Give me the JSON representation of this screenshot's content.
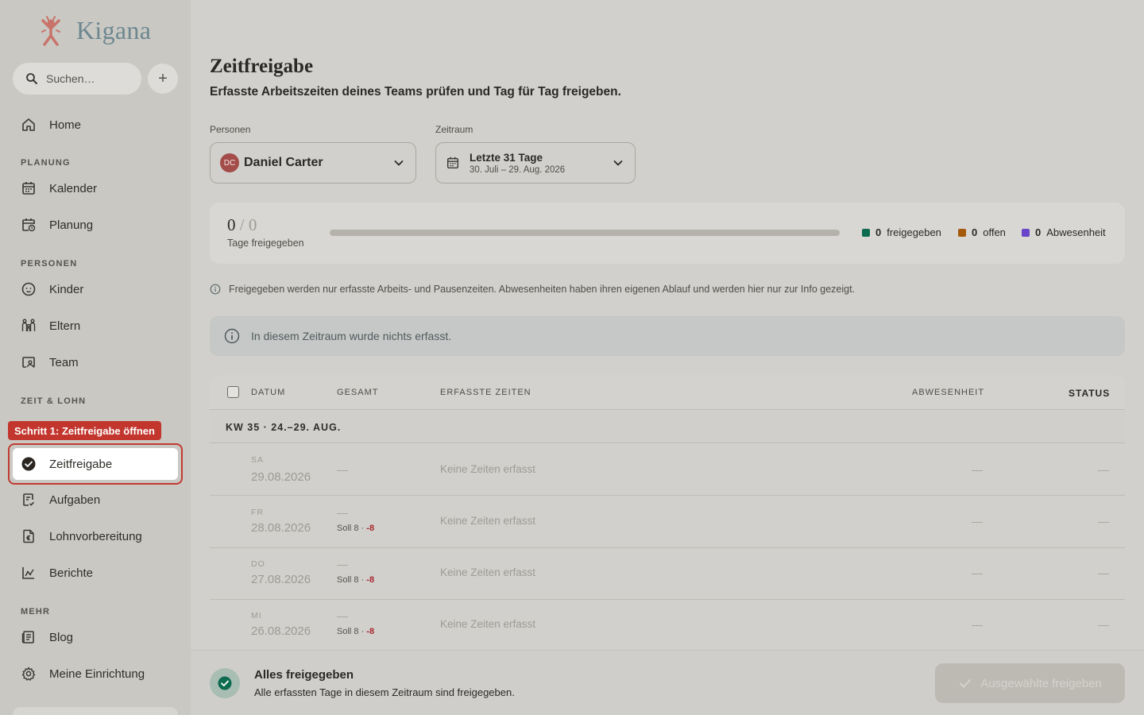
{
  "sidebar": {
    "brand": "Kigana",
    "search_placeholder": "Suchen…",
    "add_label": "+",
    "home": "Home",
    "sections": {
      "planung": "PLANUNG",
      "personen": "PERSONEN",
      "zeit_lohn": "ZEIT & LOHN",
      "mehr": "MEHR"
    },
    "items": {
      "kalender": "Kalender",
      "planung": "Planung",
      "kinder": "Kinder",
      "eltern": "Eltern",
      "team": "Team",
      "zeitfreigabe": "Zeitfreigabe",
      "aufgaben": "Aufgaben",
      "lohnvorbereitung": "Lohnvorbereitung",
      "berichte": "Berichte",
      "blog": "Blog",
      "einrichtung": "Meine Einrichtung"
    },
    "tooltip": "Schritt 1: Zeitfreigabe öffnen"
  },
  "header": {
    "title": "Zeitfreigabe",
    "subtitle": "Erfasste Arbeitszeiten deines Teams prüfen und Tag für Tag freigeben."
  },
  "filters": {
    "persons_label": "Personen",
    "person_initials": "DC",
    "person_name": "Daniel Carter",
    "period_label": "Zeitraum",
    "period_value": "Letzte 31 Tage",
    "period_range": "30. Juli – 29. Aug. 2026"
  },
  "progress": {
    "approved": "0",
    "slash": "/",
    "total": "0",
    "label": "Tage freigegeben",
    "fraction": 0,
    "legend": [
      {
        "count": "0",
        "label": "freigegeben",
        "color": "#0d6b4f"
      },
      {
        "count": "0",
        "label": "offen",
        "color": "#a45a0a"
      },
      {
        "count": "0",
        "label": "Abwesenheit",
        "color": "#6a45c9"
      }
    ]
  },
  "info_text": "Freigegeben werden nur erfasste Arbeits- und Pausenzeiten. Abwesenheiten haben ihren eigenen Ablauf und werden hier nur zur Info gezeigt.",
  "empty_text": "In diesem Zeitraum wurde nichts erfasst.",
  "table": {
    "headers": {
      "datum": "DATUM",
      "gesamt": "GESAMT",
      "zeiten": "ERFASSTE ZEITEN",
      "abwesenheit": "ABWESENHEIT",
      "status": "STATUS"
    },
    "week": "KW 35 · 24.–29. AUG.",
    "rows": [
      {
        "dow": "SA",
        "date": "29.08.2026",
        "total": "—",
        "soll": "",
        "diff": "",
        "times": "Keine Zeiten erfasst",
        "absence": "—",
        "status": "—"
      },
      {
        "dow": "FR",
        "date": "28.08.2026",
        "total": "—",
        "soll": "Soll 8 · ",
        "diff": "-8",
        "times": "Keine Zeiten erfasst",
        "absence": "—",
        "status": "—"
      },
      {
        "dow": "DO",
        "date": "27.08.2026",
        "total": "—",
        "soll": "Soll 8 · ",
        "diff": "-8",
        "times": "Keine Zeiten erfasst",
        "absence": "—",
        "status": "—"
      },
      {
        "dow": "MI",
        "date": "26.08.2026",
        "total": "—",
        "soll": "Soll 8 · ",
        "diff": "-8",
        "times": "Keine Zeiten erfasst",
        "absence": "—",
        "status": "—"
      }
    ]
  },
  "footer": {
    "title": "Alles freigegeben",
    "subtitle": "Alle erfassten Tage in diesem Zeitraum sind freigegeben.",
    "button": "Ausgewählte freigeben"
  }
}
